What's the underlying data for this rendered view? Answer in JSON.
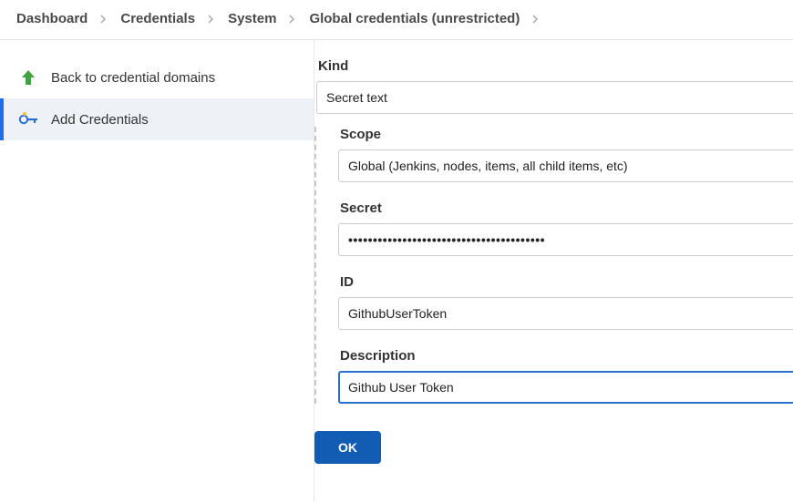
{
  "breadcrumb": {
    "items": [
      {
        "label": "Dashboard"
      },
      {
        "label": "Credentials"
      },
      {
        "label": "System"
      },
      {
        "label": "Global credentials (unrestricted)"
      }
    ]
  },
  "sidebar": {
    "items": [
      {
        "label": "Back to credential domains"
      },
      {
        "label": "Add Credentials"
      }
    ]
  },
  "form": {
    "kind_label": "Kind",
    "kind_value": "Secret text",
    "scope_label": "Scope",
    "scope_value": "Global (Jenkins, nodes, items, all child items, etc)",
    "secret_label": "Secret",
    "secret_value": "••••••••••••••••••••••••••••••••••••••••",
    "id_label": "ID",
    "id_value": "GithubUserToken",
    "description_label": "Description",
    "description_value": "Github User Token",
    "submit_label": "OK"
  }
}
